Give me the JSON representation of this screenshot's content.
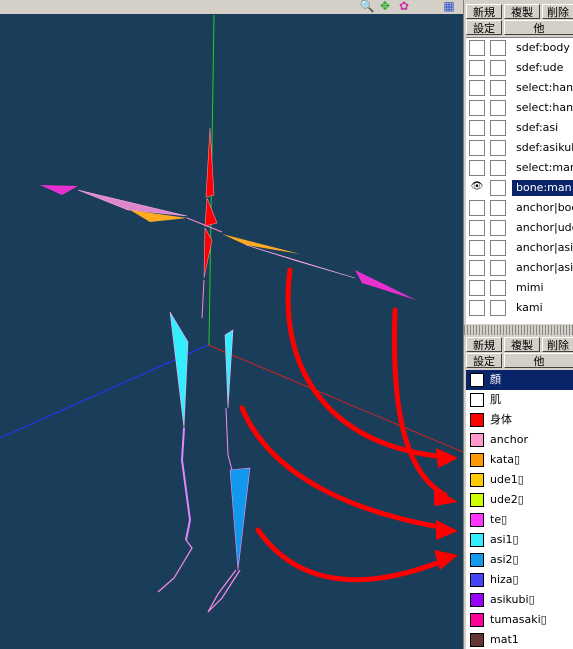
{
  "viewport": {
    "toolbar_icons": [
      {
        "icon": "magnify-icon",
        "glyph": "🔍"
      },
      {
        "icon": "move-icon",
        "glyph": "✥"
      },
      {
        "icon": "rotate-icon",
        "glyph": "✿"
      },
      {
        "icon": "color-icon",
        "glyph": "▦"
      }
    ]
  },
  "object_panel": {
    "buttons": {
      "new": "新規",
      "copy": "複製",
      "delete": "削除",
      "settings": "設定",
      "other": "他"
    },
    "objects": [
      {
        "name": "sdef:body",
        "visible": false,
        "selected": false
      },
      {
        "name": "sdef:ude",
        "visible": false,
        "selected": false
      },
      {
        "name": "select:handle",
        "visible": false,
        "selected": false
      },
      {
        "name": "select:handle",
        "visible": false,
        "selected": false
      },
      {
        "name": "sdef:asi",
        "visible": false,
        "selected": false
      },
      {
        "name": "sdef:asikubi",
        "visible": false,
        "selected": false
      },
      {
        "name": "select:manfa",
        "visible": false,
        "selected": false
      },
      {
        "name": "bone:man",
        "visible": true,
        "selected": true
      },
      {
        "name": "anchor|body",
        "visible": false,
        "selected": false
      },
      {
        "name": "anchor|ude",
        "visible": false,
        "selected": false
      },
      {
        "name": "anchor|asi",
        "visible": false,
        "selected": false
      },
      {
        "name": "anchor|asiku",
        "visible": false,
        "selected": false
      },
      {
        "name": "mimi",
        "visible": false,
        "selected": false
      },
      {
        "name": "kami",
        "visible": false,
        "selected": false
      }
    ]
  },
  "material_panel": {
    "buttons": {
      "new": "新規",
      "copy": "複製",
      "delete": "削除",
      "settings": "設定",
      "other": "他"
    },
    "materials": [
      {
        "name": "顔",
        "color": "#ffffff",
        "selected": true
      },
      {
        "name": "肌",
        "color": "#ffffff",
        "selected": false
      },
      {
        "name": "身体",
        "color": "#ff0000",
        "selected": false
      },
      {
        "name": "anchor",
        "color": "#ff99cc",
        "selected": false
      },
      {
        "name": "kata▯",
        "color": "#ff9900",
        "selected": false
      },
      {
        "name": "ude1▯",
        "color": "#ffcc00",
        "selected": false
      },
      {
        "name": "ude2▯",
        "color": "#ccff00",
        "selected": false
      },
      {
        "name": "te▯",
        "color": "#ff33ff",
        "selected": false
      },
      {
        "name": "asi1▯",
        "color": "#33eeff",
        "selected": false
      },
      {
        "name": "asi2▯",
        "color": "#1199ee",
        "selected": false
      },
      {
        "name": "hiza▯",
        "color": "#4444ff",
        "selected": false
      },
      {
        "name": "asikubi▯",
        "color": "#9900ff",
        "selected": false
      },
      {
        "name": "tumasaki▯",
        "color": "#ff0099",
        "selected": false
      },
      {
        "name": "mat1",
        "color": "#663333",
        "selected": false
      }
    ]
  }
}
